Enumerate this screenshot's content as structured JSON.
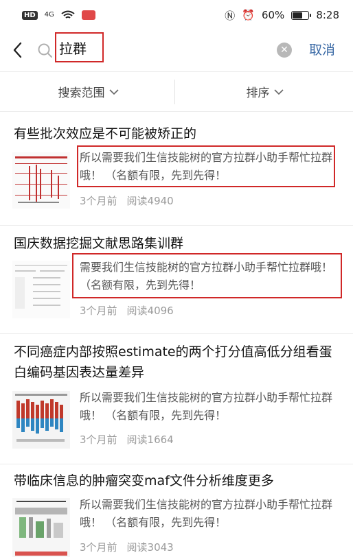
{
  "status_bar": {
    "hd": "HD",
    "network": "4G",
    "battery_text": "60%",
    "battery_level": 0.6,
    "time": "8:28"
  },
  "search": {
    "query": "拉群",
    "cancel_label": "取消"
  },
  "filters": {
    "scope_label": "搜索范围",
    "sort_label": "排序"
  },
  "results": [
    {
      "title": "有些批次效应是不可能被矫正的",
      "snippet": "所以需要我们生信技能树的官方拉群小助手帮忙拉群哦！  （名额有限，先到先得！",
      "time": "3个月前",
      "reads": "阅读4940",
      "highlighted": true
    },
    {
      "title": "国庆数据挖掘文献思路集训群",
      "snippet": "需要我们生信技能树的官方拉群小助手帮忙拉群哦！  （名额有限，先到先得！",
      "time": "3个月前",
      "reads": "阅读4096",
      "highlighted": true
    },
    {
      "title": "不同癌症内部按照estimate的两个打分值高低分组看蛋白编码基因表达量差异",
      "snippet": "所以需要我们生信技能树的官方拉群小助手帮忙拉群哦！  （名额有限，先到先得！",
      "time": "3个月前",
      "reads": "阅读1664",
      "highlighted": false
    },
    {
      "title": "带临床信息的肿瘤突变maf文件分析维度更多",
      "snippet": "所以需要我们生信技能树的官方拉群小助手帮忙拉群哦！  （名额有限，先到先得！",
      "time": "3个月前",
      "reads": "阅读3043",
      "highlighted": false
    }
  ],
  "colors": {
    "highlight_red": "#d02828",
    "cancel_blue": "#3b6aa6"
  }
}
